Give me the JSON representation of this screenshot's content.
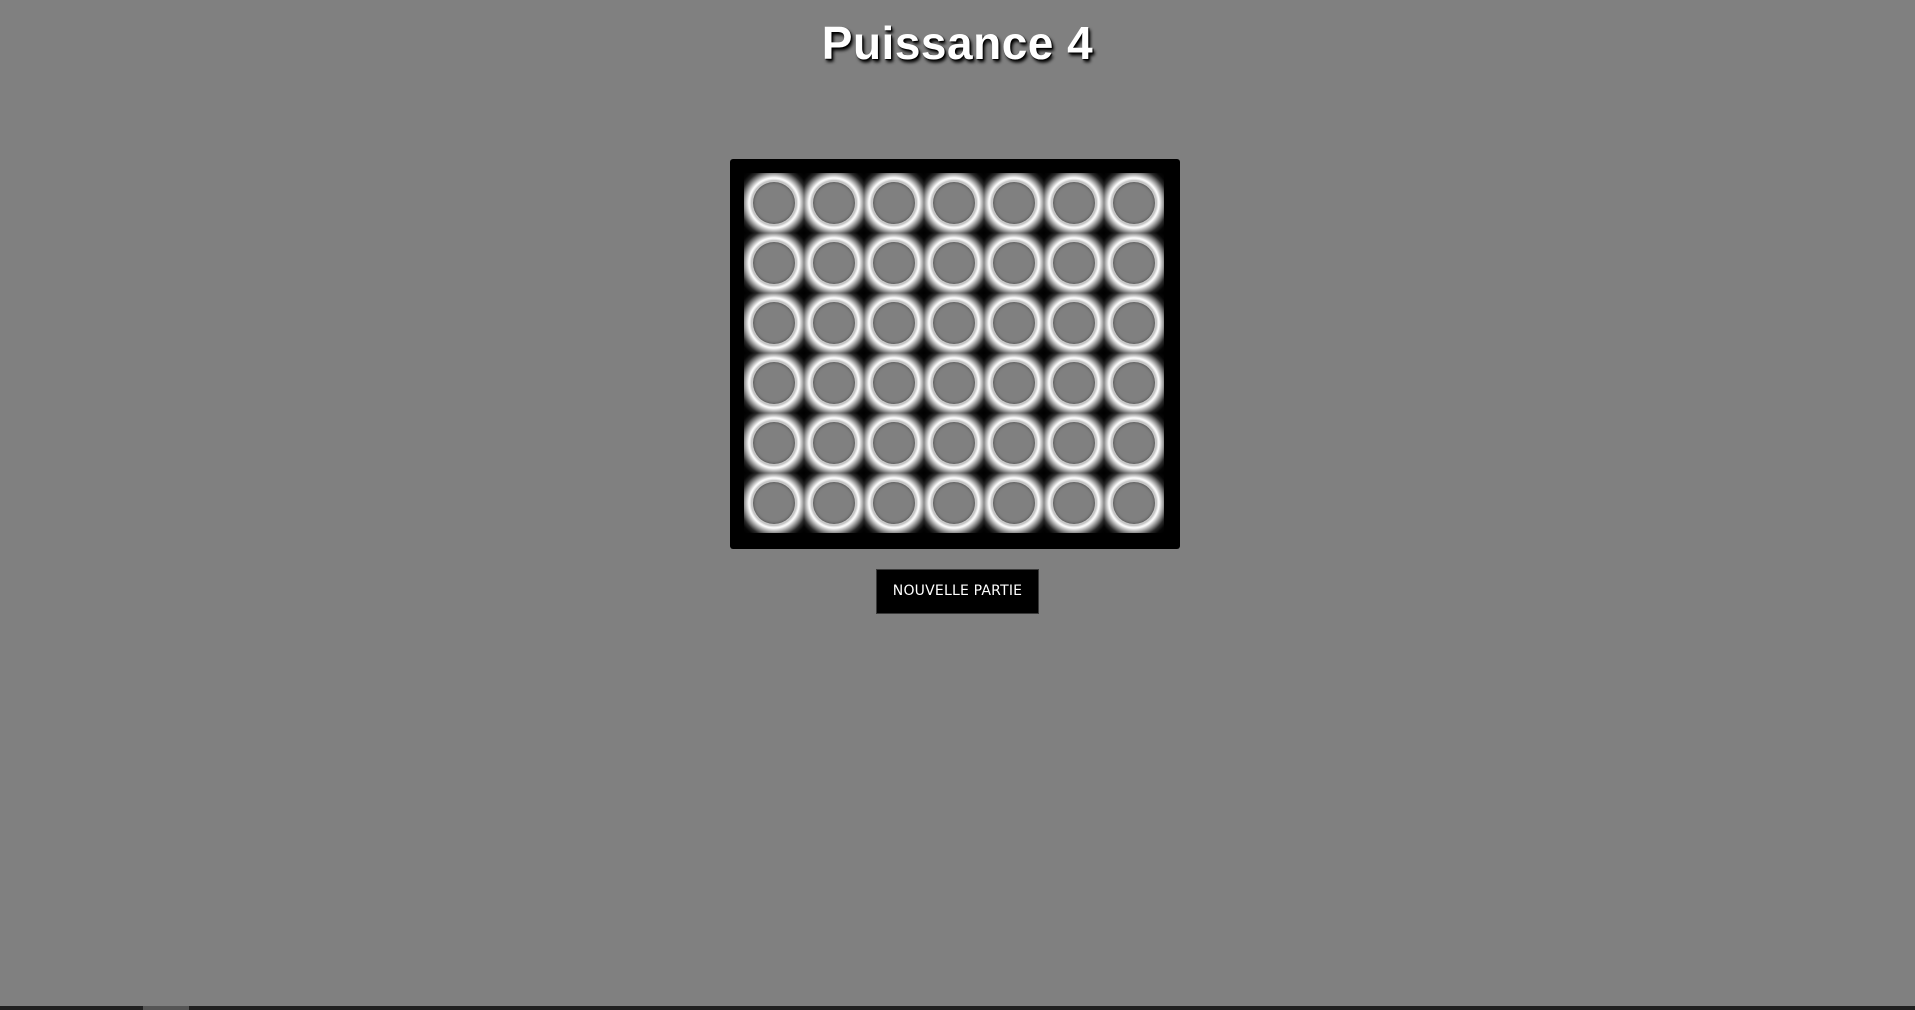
{
  "header": {
    "title": "Puissance 4"
  },
  "board": {
    "rows": 6,
    "columns": 7,
    "cells": [
      [
        "",
        "",
        "",
        "",
        "",
        "",
        ""
      ],
      [
        "",
        "",
        "",
        "",
        "",
        "",
        ""
      ],
      [
        "",
        "",
        "",
        "",
        "",
        "",
        ""
      ],
      [
        "",
        "",
        "",
        "",
        "",
        "",
        ""
      ],
      [
        "",
        "",
        "",
        "",
        "",
        "",
        ""
      ],
      [
        "",
        "",
        "",
        "",
        "",
        "",
        ""
      ]
    ]
  },
  "controls": {
    "new_game_label": "NOUVELLE PARTIE"
  },
  "colors": {
    "background": "#808080",
    "board": "#000000",
    "button": "#000000",
    "title": "#ffffff"
  }
}
